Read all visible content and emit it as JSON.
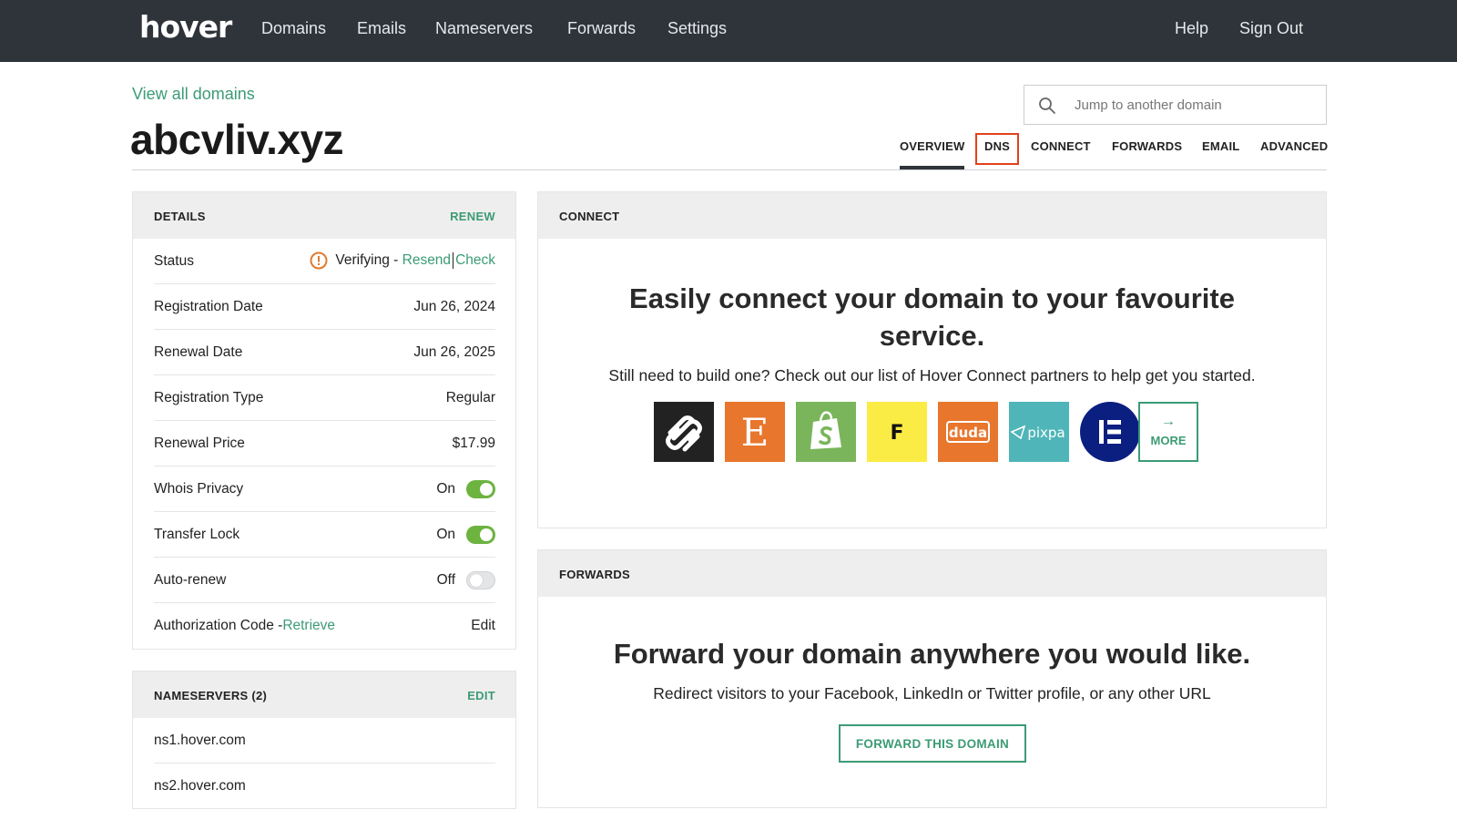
{
  "nav": {
    "logo": "hover",
    "links": [
      "Domains",
      "Emails",
      "Nameservers",
      "Forwards",
      "Settings"
    ],
    "right_links": [
      "Help",
      "Sign Out"
    ]
  },
  "header": {
    "view_all": "View all domains",
    "domain": "abcvliv.xyz",
    "search_placeholder": "Jump to another domain",
    "tabs": [
      "OVERVIEW",
      "DNS",
      "CONNECT",
      "FORWARDS",
      "EMAIL",
      "ADVANCED"
    ],
    "active_tab": "OVERVIEW",
    "highlighted_tab": "DNS"
  },
  "details": {
    "title": "DETAILS",
    "action": "RENEW",
    "status_label": "Status",
    "status_value": "Verifying -",
    "status_resend": "Resend",
    "status_check": "Check",
    "rows": [
      {
        "label": "Registration Date",
        "value": "Jun 26, 2024"
      },
      {
        "label": "Renewal Date",
        "value": "Jun 26, 2025"
      },
      {
        "label": "Registration Type",
        "value": "Regular"
      },
      {
        "label": "Renewal Price",
        "value": "$17.99"
      }
    ],
    "toggles": [
      {
        "label": "Whois Privacy",
        "state": "On"
      },
      {
        "label": "Transfer Lock",
        "state": "On"
      },
      {
        "label": "Auto-renew",
        "state": "Off"
      }
    ],
    "auth_label": "Authorization Code -",
    "auth_retrieve": "Retrieve",
    "auth_edit": "Edit"
  },
  "nameservers": {
    "title": "NAMESERVERS (2)",
    "action": "EDIT",
    "items": [
      "ns1.hover.com",
      "ns2.hover.com"
    ]
  },
  "connect": {
    "title": "CONNECT",
    "heading_line1": "Easily connect your domain to your favourite",
    "heading_line2": "service.",
    "subtitle": "Still need to build one? Check out our list of Hover Connect partners to help get you started.",
    "partners": [
      {
        "name": "squarespace",
        "color": "#222222"
      },
      {
        "name": "etsy",
        "color": "#e8762d",
        "text": "E"
      },
      {
        "name": "shopify",
        "color": "#7ab55c"
      },
      {
        "name": "format",
        "color": "#fbec45",
        "text": "F"
      },
      {
        "name": "duda",
        "color": "#e8762d",
        "text": "duda"
      },
      {
        "name": "pixpa",
        "color": "#4fb5b8",
        "text": "pixpa"
      },
      {
        "name": "elementor",
        "color": "#0b1f80"
      }
    ],
    "more_label": "MORE"
  },
  "forwards": {
    "title": "FORWARDS",
    "heading": "Forward your domain anywhere you would like.",
    "subtitle": "Redirect visitors to your Facebook, LinkedIn or Twitter profile, or any other URL",
    "button": "FORWARD THIS DOMAIN"
  },
  "colors": {
    "nav_bg": "#2f343b",
    "accent_green": "#3c9b76",
    "toggle_green": "#6cb33f",
    "warning_orange": "#e07a2f",
    "tab_highlight": "#e2421a"
  }
}
